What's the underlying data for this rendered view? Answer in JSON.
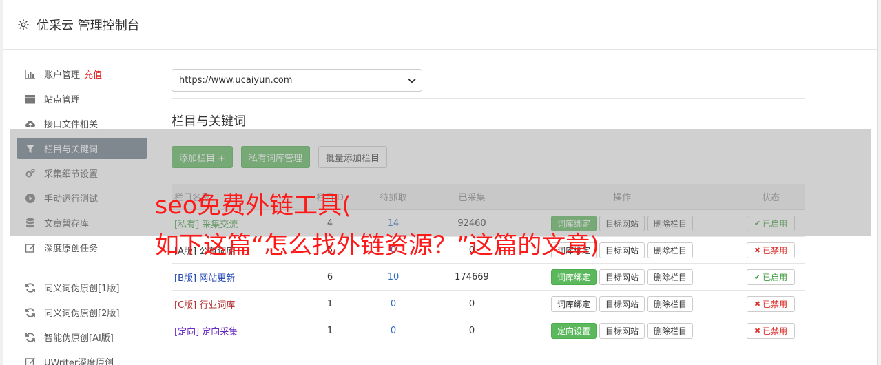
{
  "header": {
    "title": "优采云 管理控制台",
    "icon": "gear-icon"
  },
  "sidebar": {
    "items": [
      {
        "label": "账户管理",
        "extra": "充值",
        "icon": "bar-chart-icon"
      },
      {
        "label": "站点管理",
        "icon": "server-icon"
      },
      {
        "label": "接口文件相关",
        "icon": "cloud-upload-icon"
      },
      {
        "label": "栏目与关键词",
        "icon": "filter-icon",
        "active": true
      },
      {
        "label": "采集细节设置",
        "icon": "cogs-icon"
      },
      {
        "label": "手动运行测试",
        "icon": "play-circle-icon"
      },
      {
        "label": "文章暂存库",
        "icon": "database-icon"
      },
      {
        "label": "深度原创任务",
        "icon": "edit-icon"
      }
    ],
    "items2": [
      {
        "label": "同义词伪原创[1版]",
        "icon": "refresh-icon"
      },
      {
        "label": "同义词伪原创[2版]",
        "icon": "refresh-icon"
      },
      {
        "label": "智能伪原创[AI版]",
        "icon": "refresh-icon"
      },
      {
        "label": "UWriter深度原创",
        "icon": "edit-icon"
      }
    ]
  },
  "main": {
    "site_select": "https://www.ucaiyun.com",
    "section_title": "栏目与关键词",
    "buttons": {
      "add": "添加栏目 +",
      "private": "私有词库管理",
      "batch": "批量添加栏目"
    },
    "table": {
      "headers": {
        "name": "栏目名称",
        "id": "栏目ID",
        "wait": "待抓取",
        "done": "已采集",
        "ops": "操作",
        "status": "状态"
      },
      "rows": [
        {
          "tag": "[私有]",
          "name": "采集交流",
          "id": "4",
          "wait": "14",
          "done": "92460",
          "op1": "词库绑定",
          "op2": "目标网站",
          "op3": "删除栏目",
          "status": "已启用"
        },
        {
          "tag": "[A版]",
          "name": "公有词库",
          "id": "5",
          "wait": "0",
          "done": "0",
          "op1": "词库绑定",
          "op2": "目标网站",
          "op3": "删除栏目",
          "status": "已禁用"
        },
        {
          "tag": "[B版]",
          "name": "网站更新",
          "id": "6",
          "wait": "10",
          "done": "174669",
          "op1": "词库绑定",
          "op2": "目标网站",
          "op3": "删除栏目",
          "status": "已启用"
        },
        {
          "tag": "[C版]",
          "name": "行业词库",
          "id": "1",
          "wait": "0",
          "done": "0",
          "op1": "词库绑定",
          "op2": "目标网站",
          "op3": "删除栏目",
          "status": "已禁用"
        },
        {
          "tag": "[定向]",
          "name": "定向采集",
          "id": "1",
          "wait": "0",
          "done": "0",
          "op1": "定向设置",
          "op2": "目标网站",
          "op3": "删除栏目",
          "status": "已禁用"
        }
      ]
    }
  },
  "watermark": {
    "line1": "seo免费外链工具(",
    "line2": "如下这篇“怎么找外链资源？”这篇的文章)"
  }
}
